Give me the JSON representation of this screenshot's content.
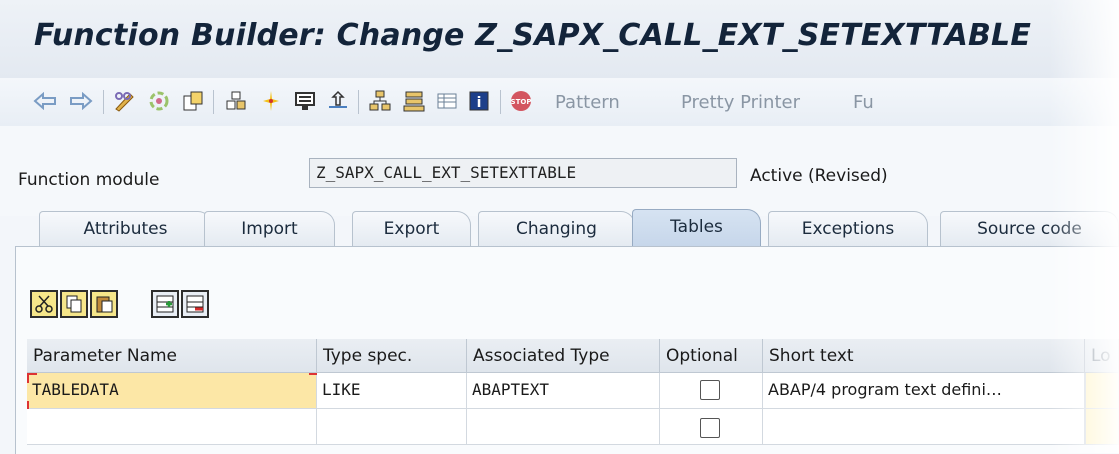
{
  "window": {
    "title": "Function Builder: Change Z_SAPX_CALL_EXT_SETEXTTABLE"
  },
  "toolbar": {
    "icons": [
      "back-arrow-icon",
      "forward-arrow-icon",
      "pencil-glasses-icon",
      "activate-icon",
      "object-list-icon",
      "where-used-icon",
      "enhance-icon",
      "display-object-icon",
      "navigate-icon",
      "hierarchy-icon",
      "object-stack-icon",
      "table-icon",
      "info-icon",
      "stop-icon"
    ],
    "pattern_label": "Pattern",
    "pretty_printer_label": "Pretty Printer",
    "truncated_label": "Fu"
  },
  "header": {
    "function_module_label": "Function module",
    "function_module_value": "Z_SAPX_CALL_EXT_SETEXTTABLE",
    "status": "Active (Revised)"
  },
  "tabs": [
    {
      "label": "Attributes"
    },
    {
      "label": "Import"
    },
    {
      "label": "Export"
    },
    {
      "label": "Changing"
    },
    {
      "label": "Tables",
      "active": true
    },
    {
      "label": "Exceptions"
    },
    {
      "label": "Source code"
    }
  ],
  "grid_toolbar": {
    "icons": [
      "cut-icon",
      "copy-icon",
      "paste-icon",
      "insert-row-icon",
      "delete-row-icon"
    ]
  },
  "table": {
    "columns": [
      "Parameter Name",
      "Type spec.",
      "Associated Type",
      "Optional",
      "Short text",
      "Lo"
    ],
    "rows": [
      {
        "parameter": "TABLEDATA",
        "type_spec": "LIKE",
        "associated_type": "ABAPTEXT",
        "optional": false,
        "short_text": "ABAP/4 program text defini…"
      },
      {
        "parameter": "",
        "type_spec": "",
        "associated_type": "",
        "optional": false,
        "short_text": ""
      }
    ]
  }
}
